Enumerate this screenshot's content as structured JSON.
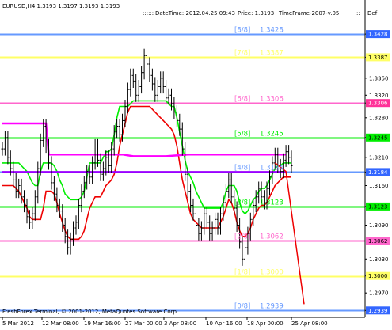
{
  "chart_data": {
    "type": "line",
    "symbol_header": "EURUSD,H4  1.3193 1.3197 1.3193 1.3193",
    "info_bar": {
      "datetime": "DateTime: 2012.04.25 09:43",
      "price": "Price: 1.3193",
      "timeframe": "TimeFrame-2007-v.05",
      "cut_label": "Def"
    },
    "copyright": "FreshForex Terminal, © 2001-2012, MetaQuotes Software Corp.",
    "x_tick_labels": [
      "5 Mar 2012",
      "12 Mar 08:00",
      "19 Mar 16:00",
      "27 Mar 00:00",
      "3 Apr 08:00",
      "10 Apr 16:00",
      "18 Apr 00:00",
      "25 Apr 08:00"
    ],
    "y_ticks": [
      "1.3428",
      "1.3387",
      "1.3350",
      "1.3320",
      "1.3306",
      "1.3280",
      "1.3245",
      "1.3210",
      "1.3184",
      "1.3160",
      "1.3123",
      "1.3090",
      "1.3062",
      "1.3030",
      "1.3000",
      "1.2970",
      "1.2939"
    ],
    "ylim": [
      1.2931,
      1.3445
    ],
    "murrey_levels": [
      {
        "label": "[8/8]",
        "value": "1.3428",
        "color": "#6699ff"
      },
      {
        "label": "[7/8]",
        "value": "1.3387",
        "color": "#ffff66"
      },
      {
        "label": "[6/8]",
        "value": "1.3306",
        "color": "#ff66cc"
      },
      {
        "label": "[5/8]",
        "value": "1.3245",
        "color": "#00ee00"
      },
      {
        "label": "[4/8]",
        "value": "1.3184",
        "color": "#6699ff"
      },
      {
        "label": "[3/8]",
        "value": "1.3123",
        "color": "#00ee00"
      },
      {
        "label": "[2/8]",
        "value": "1.3062",
        "color": "#ff66cc"
      },
      {
        "label": "[1/8]",
        "value": "1.3000",
        "color": "#ffff66"
      },
      {
        "label": "[0/8]",
        "value": "1.2939",
        "color": "#6699ff"
      }
    ],
    "price_axis_tags": [
      {
        "value": "1.3428",
        "color": "#3366ff"
      },
      {
        "value": "1.3387",
        "color": "#ffff66"
      },
      {
        "value": "1.3306",
        "color": "#ff3399"
      },
      {
        "value": "1.3245",
        "color": "#00ee00"
      },
      {
        "value": "1.3184",
        "color": "#3366ff"
      },
      {
        "value": "1.3123",
        "color": "#00ee00"
      },
      {
        "value": "1.3062",
        "color": "#ff66cc"
      },
      {
        "value": "1.3000",
        "color": "#ffff66"
      },
      {
        "value": "1.2939",
        "color": "#3366ff"
      }
    ],
    "grid": false,
    "colors": {
      "background": "#ffffff",
      "candles": "#000000",
      "channel_upper": "#00ee00",
      "channel_lower": "#ee0000",
      "frame_line_1": "#ff00ff",
      "frame_line_2": "#9900ff",
      "forecast_line": "#ee0000"
    },
    "close_series": [
      1.3225,
      1.3245,
      1.321,
      1.319,
      1.317,
      1.315,
      1.316,
      1.314,
      1.3125,
      1.3105,
      1.3095,
      1.311,
      1.314,
      1.319,
      1.324,
      1.3265,
      1.323,
      1.32,
      1.3165,
      1.3145,
      1.3125,
      1.3115,
      1.309,
      1.307,
      1.305,
      1.3065,
      1.3085,
      1.3095,
      1.3125,
      1.315,
      1.3165,
      1.3185,
      1.3175,
      1.32,
      1.323,
      1.3205,
      1.318,
      1.319,
      1.321,
      1.3195,
      1.3225,
      1.3255,
      1.3265,
      1.325,
      1.3275,
      1.33,
      1.333,
      1.3355,
      1.3345,
      1.332,
      1.3335,
      1.336,
      1.339,
      1.3375,
      1.3355,
      1.334,
      1.332,
      1.3335,
      1.335,
      1.3335,
      1.3315,
      1.332,
      1.3305,
      1.329,
      1.3275,
      1.326,
      1.3225,
      1.318,
      1.315,
      1.3125,
      1.311,
      1.309,
      1.3075,
      1.3085,
      1.311,
      1.3095,
      1.3075,
      1.3085,
      1.31,
      1.3085,
      1.311,
      1.313,
      1.315,
      1.317,
      1.314,
      1.312,
      1.309,
      1.306,
      1.303,
      1.305,
      1.3075,
      1.31,
      1.3125,
      1.314,
      1.3155,
      1.314,
      1.313,
      1.3155,
      1.3175,
      1.32,
      1.3215,
      1.3195,
      1.3185,
      1.3205,
      1.322,
      1.321,
      1.3195
    ],
    "channel_upper": [
      1.32,
      1.32,
      1.32,
      1.32,
      1.32,
      1.32,
      1.32,
      1.3195,
      1.319,
      1.3185,
      1.3175,
      1.3165,
      1.316,
      1.316,
      1.3185,
      1.32,
      1.32,
      1.32,
      1.32,
      1.3195,
      1.3185,
      1.317,
      1.316,
      1.3145,
      1.314,
      1.3135,
      1.3135,
      1.3135,
      1.3135,
      1.314,
      1.315,
      1.3175,
      1.32,
      1.32,
      1.32,
      1.32,
      1.32,
      1.321,
      1.322,
      1.322,
      1.3225,
      1.325,
      1.328,
      1.33,
      1.33,
      1.33,
      1.33,
      1.3305,
      1.331,
      1.331,
      1.331,
      1.331,
      1.331,
      1.331,
      1.331,
      1.331,
      1.331,
      1.331,
      1.331,
      1.331,
      1.331,
      1.3305,
      1.33,
      1.33,
      1.328,
      1.3255,
      1.323,
      1.3205,
      1.3185,
      1.3175,
      1.3165,
      1.315,
      1.314,
      1.313,
      1.312,
      1.312,
      1.312,
      1.312,
      1.312,
      1.312,
      1.312,
      1.313,
      1.315,
      1.316,
      1.316,
      1.316,
      1.315,
      1.313,
      1.3115,
      1.311,
      1.3115,
      1.3125,
      1.3135,
      1.314,
      1.315,
      1.3155,
      1.3155,
      1.316,
      1.317,
      1.318,
      1.319,
      1.3195,
      1.3195,
      1.32,
      1.32,
      1.32,
      1.32
    ],
    "channel_lower": [
      1.316,
      1.316,
      1.316,
      1.316,
      1.316,
      1.3155,
      1.315,
      1.314,
      1.313,
      1.312,
      1.3105,
      1.31,
      1.31,
      1.31,
      1.31,
      1.312,
      1.315,
      1.315,
      1.315,
      1.3145,
      1.313,
      1.311,
      1.3095,
      1.308,
      1.307,
      1.3065,
      1.3065,
      1.3065,
      1.3065,
      1.307,
      1.308,
      1.31,
      1.312,
      1.313,
      1.314,
      1.314,
      1.314,
      1.315,
      1.316,
      1.3165,
      1.317,
      1.318,
      1.32,
      1.323,
      1.325,
      1.327,
      1.329,
      1.33,
      1.33,
      1.33,
      1.33,
      1.33,
      1.33,
      1.33,
      1.33,
      1.3295,
      1.329,
      1.3285,
      1.328,
      1.3275,
      1.327,
      1.3265,
      1.326,
      1.325,
      1.323,
      1.32,
      1.317,
      1.315,
      1.313,
      1.311,
      1.31,
      1.3095,
      1.309,
      1.3085,
      1.3085,
      1.3085,
      1.3085,
      1.3085,
      1.3085,
      1.3085,
      1.3095,
      1.3105,
      1.312,
      1.3135,
      1.313,
      1.3115,
      1.3095,
      1.308,
      1.307,
      1.307,
      1.3075,
      1.3085,
      1.31,
      1.311,
      1.312,
      1.3125,
      1.3125,
      1.313,
      1.314,
      1.315,
      1.316,
      1.3165,
      1.317,
      1.3175,
      1.3175,
      1.3175,
      1.3175
    ],
    "frame_line_1": [
      [
        0,
        1.327
      ],
      [
        16,
        1.327
      ],
      [
        17,
        1.3215
      ],
      [
        44,
        1.3215
      ],
      [
        48,
        1.3212
      ],
      [
        60,
        1.3212
      ],
      [
        68,
        1.3215
      ],
      [
        79,
        1.3215
      ],
      [
        83,
        1.3215
      ],
      [
        104,
        1.3215
      ]
    ],
    "frame_line_2": [
      [
        0,
        1.3184
      ],
      [
        104,
        1.3184
      ]
    ],
    "forecast_line": [
      [
        100,
        1.32
      ],
      [
        104,
        1.3185
      ],
      [
        110,
        1.295
      ]
    ]
  }
}
